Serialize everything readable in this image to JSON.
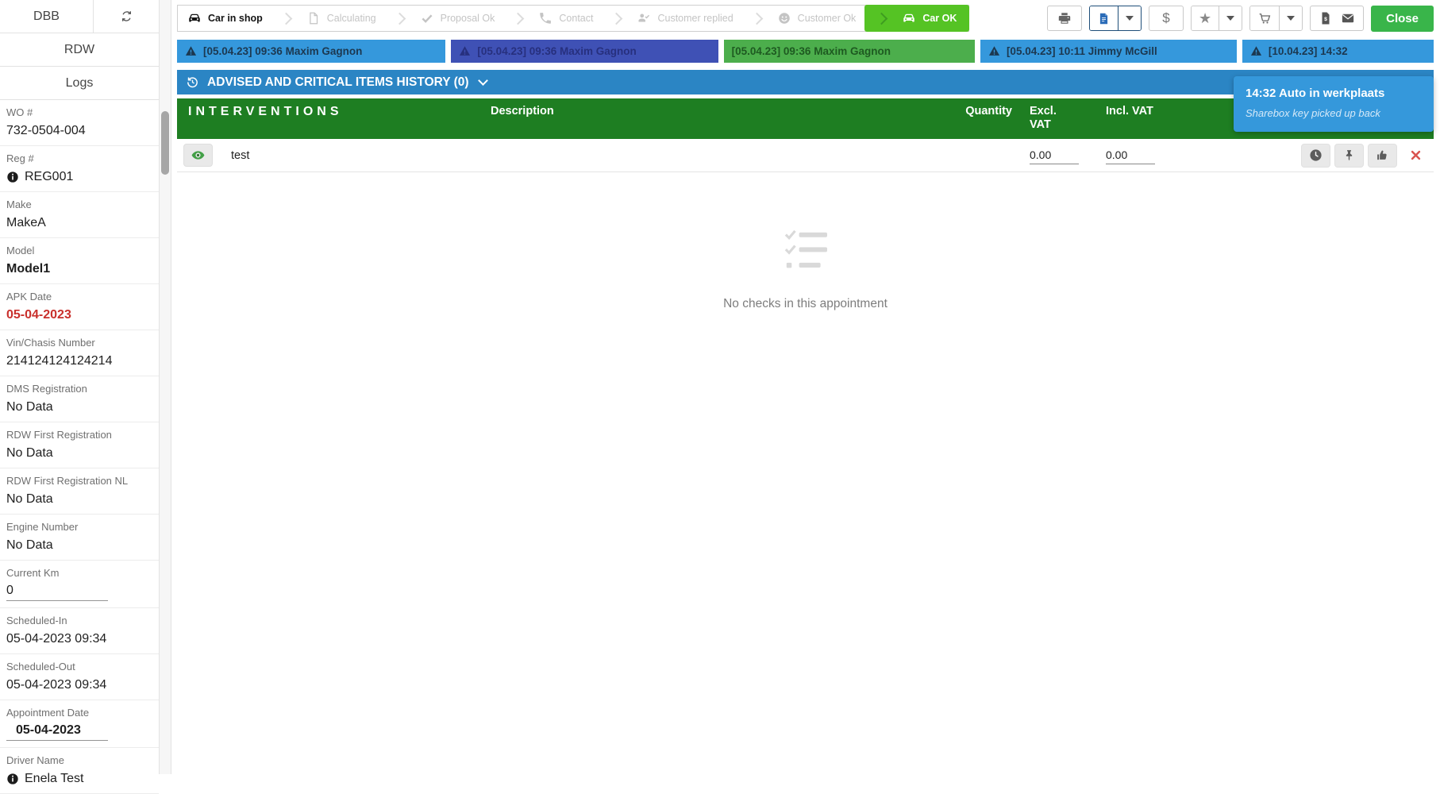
{
  "sidebar": {
    "tabs": [
      {
        "label": "DBB"
      },
      {
        "label": "RDW"
      },
      {
        "label": "Logs"
      }
    ],
    "fields": [
      {
        "label": "WO #",
        "value": "732-0504-004"
      },
      {
        "label": "Reg #",
        "value": "REG001",
        "info": true
      },
      {
        "label": "Make",
        "value": "MakeA"
      },
      {
        "label": "Model",
        "value": "Model1",
        "bold": true
      },
      {
        "label": "APK Date",
        "value": "05-04-2023",
        "bold": true,
        "value_color": "#c9302c"
      },
      {
        "label": "Vin/Chasis Number",
        "value": "214124124124214"
      },
      {
        "label": "DMS Registration",
        "value": "No Data"
      },
      {
        "label": "RDW First Registration",
        "value": "No Data"
      },
      {
        "label": "RDW First Registration NL",
        "value": "No Data"
      },
      {
        "label": "Engine Number",
        "value": "No Data"
      },
      {
        "label": "Current Km",
        "value": "0",
        "input": true
      },
      {
        "label": "Scheduled-In",
        "value": "05-04-2023 09:34"
      },
      {
        "label": "Scheduled-Out",
        "value": "05-04-2023 09:34"
      },
      {
        "label": "Appointment Date",
        "value": "05-04-2023",
        "input": true,
        "bold": true,
        "indent": true
      },
      {
        "label": "Driver Name",
        "value": "Enela Test",
        "info": true
      }
    ]
  },
  "workflow": {
    "steps": [
      {
        "label": "Car in shop",
        "icon": "car",
        "state": "active"
      },
      {
        "label": "Calculating",
        "icon": "file",
        "state": "inactive"
      },
      {
        "label": "Proposal Ok",
        "icon": "check",
        "state": "inactive"
      },
      {
        "label": "Contact",
        "icon": "phone",
        "state": "inactive"
      },
      {
        "label": "Customer replied",
        "icon": "user-check",
        "state": "inactive"
      },
      {
        "label": "Customer Ok",
        "icon": "smiley",
        "state": "inactive"
      },
      {
        "label": "Car OK",
        "icon": "car",
        "state": "done"
      }
    ]
  },
  "toolbar": {
    "close_label": "Close"
  },
  "status_bars": [
    {
      "text": "[05.04.23] 09:36 Maxim Gagnon",
      "warning": true,
      "bg": "#3598dc",
      "fg": "#1c3850"
    },
    {
      "text": "[05.04.23] 09:36 Maxim Gagnon",
      "warning": true,
      "bg": "#3f51b5",
      "fg": "#27307e"
    },
    {
      "text": "[05.04.23] 09:36 Maxim Gagnon",
      "warning": false,
      "bg": "#4cae4c",
      "fg": "#1e5a21"
    },
    {
      "text": "[05.04.23] 10:11 Jimmy McGill",
      "warning": true,
      "bg": "#3598dc",
      "fg": "#1c3850"
    },
    {
      "text": "[10.04.23] 14:32",
      "warning": true,
      "bg": "#3598dc",
      "fg": "#1c3850"
    }
  ],
  "history_bar": {
    "label": "ADVISED AND CRITICAL ITEMS HISTORY (0)"
  },
  "interventions": {
    "title": "INTERVENTIONS",
    "columns": {
      "description": "Description",
      "quantity": "Quantity",
      "excl_vat": "Excl. VAT",
      "incl_vat": "Incl. VAT"
    },
    "rows": [
      {
        "name": "test",
        "excl_vat": "0.00",
        "incl_vat": "0.00"
      }
    ]
  },
  "checks": {
    "empty_message": "No checks in this appointment"
  },
  "notification": {
    "title": "14:32 Auto in werkplaats",
    "subtitle": "Sharebox key picked up back"
  },
  "colors": {
    "bar_blue": "#3598dc",
    "bar_indigo": "#3f51b5",
    "bar_green": "#4cae4c",
    "history_blue": "#2b85c4",
    "header_green": "#1e7e22",
    "close_green": "#39b54a",
    "car_ok_green": "#55c324",
    "danger_red": "#d9534f",
    "apk_red": "#c9302c"
  }
}
